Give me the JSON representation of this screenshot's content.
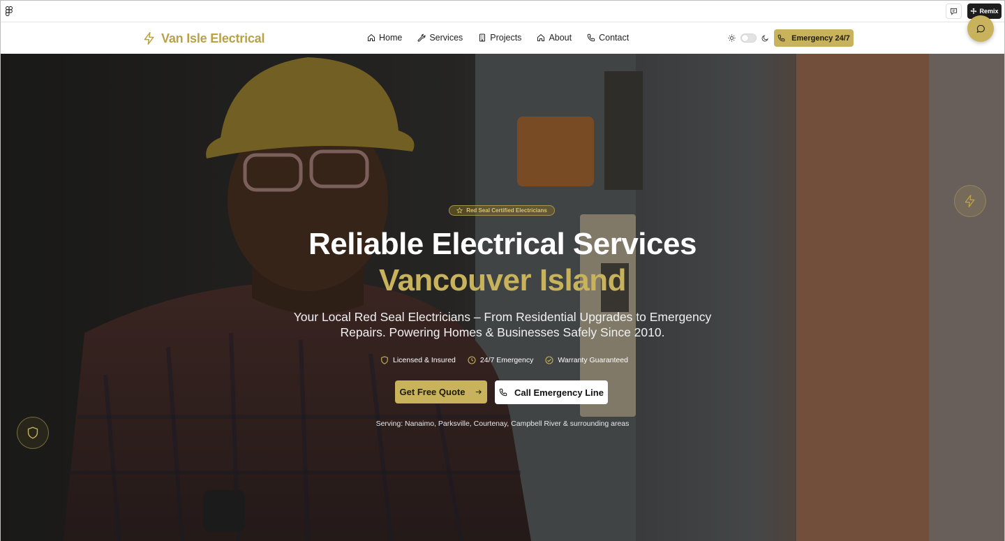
{
  "chrome": {
    "logo_icon": "figma-icon",
    "comment_icon": "comment-icon",
    "remix_label": "Remix"
  },
  "header": {
    "brand_name": "Van Isle Electrical",
    "brand_icon": "lightning-bolt-icon",
    "nav": [
      {
        "label": "Home",
        "icon": "home-icon"
      },
      {
        "label": "Services",
        "icon": "wrench-icon"
      },
      {
        "label": "Projects",
        "icon": "building-icon"
      },
      {
        "label": "About",
        "icon": "home-icon"
      },
      {
        "label": "Contact",
        "icon": "phone-icon"
      }
    ],
    "theme_toggle": {
      "state": "light"
    },
    "emergency_label": "Emergency 24/7"
  },
  "hero": {
    "badge": "Red Seal Certified Electricians",
    "title_line1": "Reliable Electrical Services",
    "title_line2": "Vancouver Island",
    "subtitle": "Your Local Red Seal Electricians – From Residential Upgrades to Emergency Repairs. Powering Homes & Businesses Safely Since 2010.",
    "features": [
      {
        "label": "Licensed & Insured",
        "icon": "shield-icon"
      },
      {
        "label": "24/7 Emergency",
        "icon": "clock-icon"
      },
      {
        "label": "Warranty Guaranteed",
        "icon": "check-circle-icon"
      }
    ],
    "cta_primary": "Get Free Quote",
    "cta_secondary": "Call Emergency Line",
    "serving": "Serving: Nanaimo, Parksville, Courtenay, Campbell River & surrounding areas"
  },
  "colors": {
    "accent": "#c8b25b",
    "brand_text": "#b8a146",
    "dark": "#1e1e1e"
  }
}
